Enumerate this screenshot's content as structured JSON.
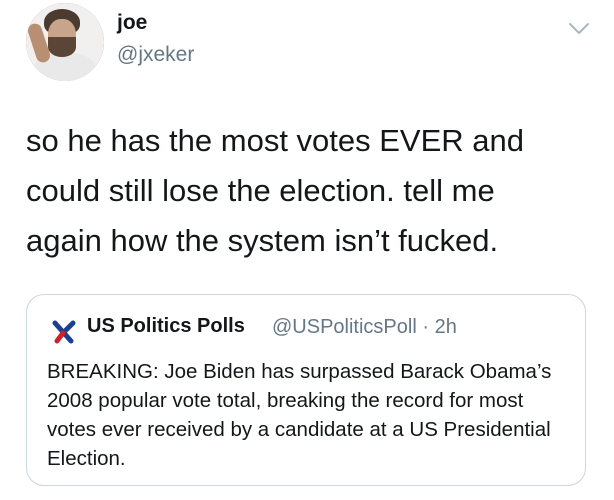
{
  "author": {
    "name": "joe",
    "handle": "@jxeker"
  },
  "tweet": {
    "text": "so he has the most votes EVER and\ncould still lose the election. tell me\nagain how the system isn’t fucked."
  },
  "quoted_tweet": {
    "name": "US Politics Polls",
    "handle": "@USPoliticsPoll",
    "separator": "·",
    "time": "2h",
    "text": "BREAKING: Joe Biden has surpassed Barack Obama’s 2008 popular vote total, breaking the record for most votes ever received by a candidate at a US Presidential Election."
  },
  "icons": {
    "menu": "chevron-down-icon",
    "quote_logo": "us-politics-polls-logo"
  },
  "colors": {
    "text": "#14171a",
    "secondary": "#657786",
    "border": "#ccd6dd",
    "logo_blue": "#1d3f8f",
    "logo_red": "#d0212b"
  }
}
